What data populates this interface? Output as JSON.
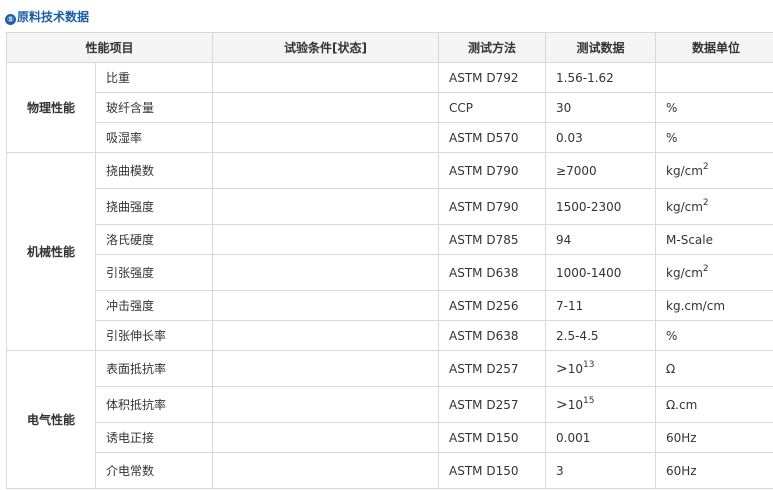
{
  "title": "原料技术数据",
  "title_icon": "⑤",
  "headers": [
    "性能项目",
    "试验条件[状态]",
    "测试方法",
    "测试数据",
    "数据单位"
  ],
  "groups": {
    "physical": "物理性能",
    "mechanical": "机械性能",
    "electrical": "电气性能"
  },
  "rows": [
    {
      "item": "比重",
      "method": "ASTM D792",
      "value": "1.56-1.62",
      "unit": ""
    },
    {
      "item": "玻纤含量",
      "method": "CCP",
      "value": "30",
      "unit": "%"
    },
    {
      "item": "吸湿率",
      "method": "ASTM D570",
      "value": "0.03",
      "unit": "%"
    },
    {
      "item": "挠曲模数",
      "method": "ASTM D790",
      "value": "≥7000",
      "unit": "kg/cm",
      "unit_sup": "2"
    },
    {
      "item": "挠曲强度",
      "method": "ASTM D790",
      "value": "1500-2300",
      "unit": "kg/cm",
      "unit_sup": "2"
    },
    {
      "item": "洛氏硬度",
      "method": "ASTM D785",
      "value": "94",
      "unit": "M-Scale"
    },
    {
      "item": "引张强度",
      "method": "ASTM D638",
      "value": "1000-1400",
      "unit": "kg/cm",
      "unit_sup": "2"
    },
    {
      "item": "冲击强度",
      "method": "ASTM D256",
      "value": "7-11",
      "unit": "kg.cm/cm"
    },
    {
      "item": "引张伸长率",
      "method": "ASTM D638",
      "value": "2.5-4.5",
      "unit": "%"
    },
    {
      "item": "表面抵抗率",
      "method": "ASTM D257",
      "value_prefix": ">",
      "value": "10",
      "value_sup": "13",
      "unit": "Ω"
    },
    {
      "item": "体积抵抗率",
      "method": "ASTM D257",
      "value_prefix": ">",
      "value": "10",
      "value_sup": "15",
      "unit": "Ω.cm"
    },
    {
      "item": "诱电正接",
      "method": "ASTM D150",
      "value": "0.001",
      "unit": "60Hz"
    },
    {
      "item": "介电常数",
      "method": "ASTM D150",
      "value": "3",
      "unit": "60Hz"
    }
  ]
}
